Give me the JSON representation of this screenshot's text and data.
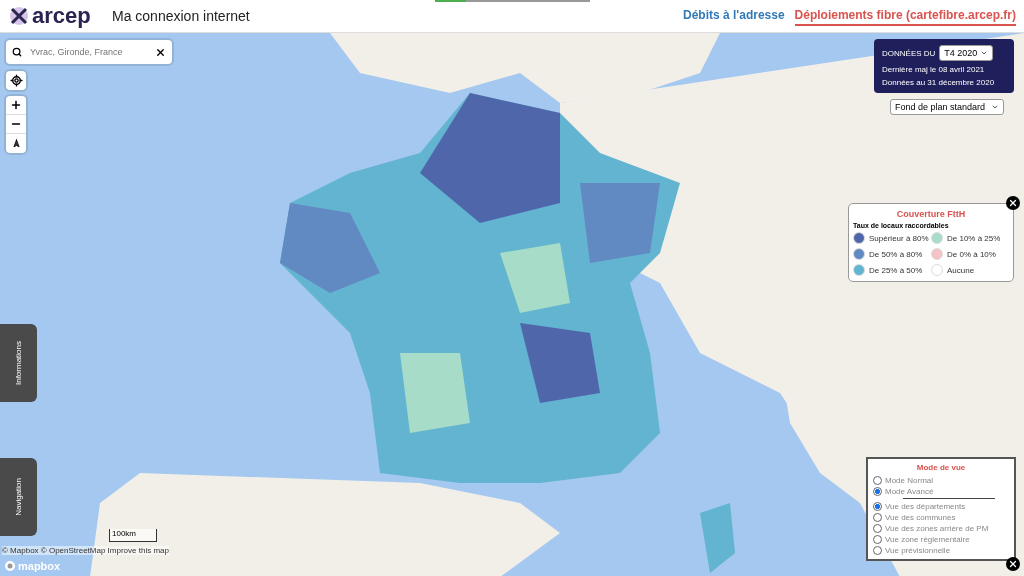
{
  "header": {
    "logo": "arcep",
    "title": "Ma connexion internet",
    "links": [
      {
        "label": "Débits à l'adresse",
        "selected": false
      },
      {
        "label": "Déploiements fibre (cartefibre.arcep.fr)",
        "selected": true
      }
    ]
  },
  "loading_bar": {
    "level": 0.2
  },
  "search": {
    "placeholder": "Yvrac, Gironde, France"
  },
  "data_panel": {
    "label": "DONNÉES DU",
    "period": "T4 2020",
    "updated": "Dernière maj le 08 avril 2021",
    "data_date": "Données au 31 décembre 2020"
  },
  "basemap_select": {
    "value": "Fond de plan standard"
  },
  "legend": {
    "title": "Couverture FttH",
    "subtitle": "Taux de locaux raccordables",
    "items": [
      {
        "label": "Supérieur à 80%",
        "color": "#4f67aa"
      },
      {
        "label": "De 10% à 25%",
        "color": "#a6dcc8"
      },
      {
        "label": "De 50% à 80%",
        "color": "#6189c2"
      },
      {
        "label": "De 0% à 10%",
        "color": "#f5c2c5"
      },
      {
        "label": "De 25% à 50%",
        "color": "#62b4d0"
      },
      {
        "label": "Aucune",
        "color": "#ffffff"
      }
    ]
  },
  "side_tabs": [
    {
      "label": "Informations"
    },
    {
      "label": "Navigation"
    }
  ],
  "scale": "100km",
  "attribution": "© Mapbox © OpenStreetMap Improve this map",
  "mapbox_logo": "mapbox",
  "view_mode": {
    "title": "Mode de vue",
    "modes": [
      {
        "label": "Mode Normal",
        "selected": false
      },
      {
        "label": "Mode Avancé",
        "selected": true
      }
    ],
    "views": [
      {
        "label": "Vue des départements",
        "selected": true
      },
      {
        "label": "Vue des communes",
        "selected": false
      },
      {
        "label": "Vue des zones arrière de PM",
        "selected": false
      },
      {
        "label": "Vue zone réglementaire",
        "selected": false
      },
      {
        "label": "Vue prévisionnelle",
        "selected": false
      }
    ]
  }
}
